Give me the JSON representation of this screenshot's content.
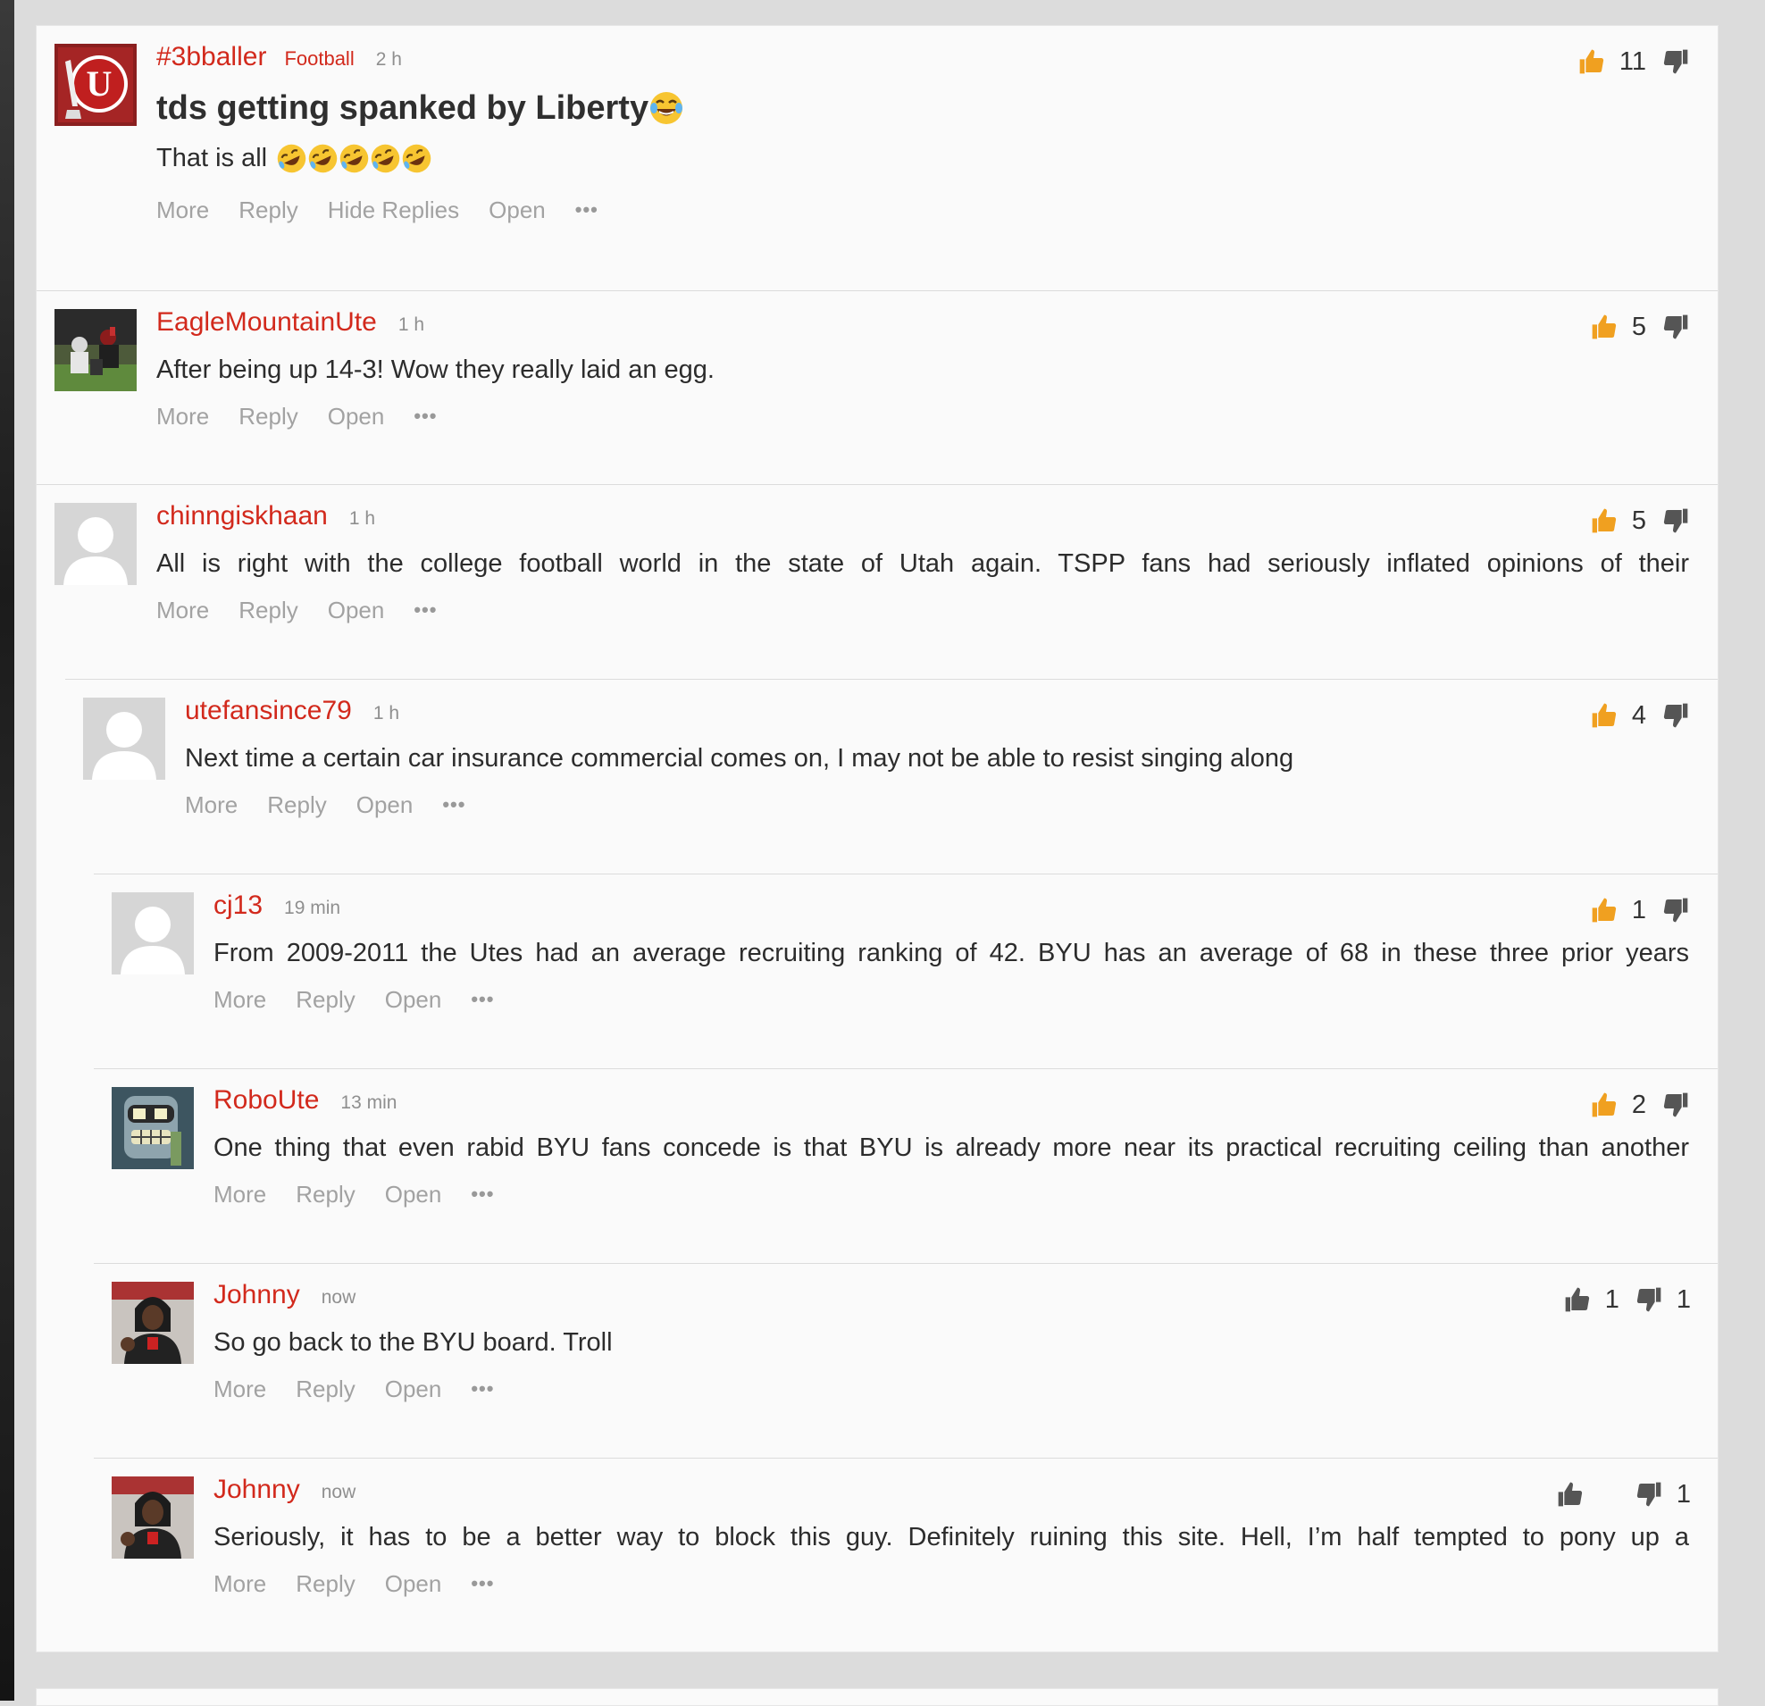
{
  "comments": [
    {
      "username": "#3bballer",
      "category": "Football",
      "time": "2 h",
      "title": "tds getting spanked by Liberty",
      "text": "That is all",
      "avatar": "utah-u-logo",
      "upvotes": "11",
      "downvotes": "",
      "up_active": true,
      "actions": [
        "More",
        "Reply",
        "Hide Replies",
        "Open"
      ]
    },
    {
      "username": "EagleMountainUte",
      "time": "1 h",
      "text": "After being up 14-3! Wow they really laid an egg.",
      "avatar": "football-photo",
      "upvotes": "5",
      "downvotes": "",
      "up_active": true,
      "actions": [
        "More",
        "Reply",
        "Open"
      ]
    },
    {
      "username": "chinngiskhaan",
      "time": "1 h",
      "text": "All is right with the college football world in the state of Utah again. TSPP fans had seriously inflated opinions of their",
      "avatar": "default-avatar",
      "upvotes": "5",
      "downvotes": "",
      "up_active": true,
      "actions": [
        "More",
        "Reply",
        "Open"
      ]
    },
    {
      "username": "utefansince79",
      "time": "1 h",
      "text": "Next time a certain car insurance commercial comes on, I may not be able to resist singing along",
      "avatar": "default-avatar",
      "upvotes": "4",
      "downvotes": "",
      "up_active": true,
      "actions": [
        "More",
        "Reply",
        "Open"
      ]
    },
    {
      "username": "cj13",
      "time": "19 min",
      "text": "From 2009-2011 the Utes had an average recruiting ranking of 42. BYU has an average of 68 in these three prior years",
      "avatar": "default-avatar",
      "upvotes": "1",
      "downvotes": "",
      "up_active": true,
      "actions": [
        "More",
        "Reply",
        "Open"
      ]
    },
    {
      "username": "RoboUte",
      "time": "13 min",
      "text": "One thing that even rabid BYU fans concede is that BYU is already more near its practical recruiting ceiling than another",
      "avatar": "robot-avatar",
      "upvotes": "2",
      "downvotes": "",
      "up_active": true,
      "actions": [
        "More",
        "Reply",
        "Open"
      ]
    },
    {
      "username": "Johnny",
      "time": "now",
      "text": "So go back to the BYU board. Troll",
      "avatar": "player-photo",
      "upvotes": "1",
      "downvotes": "1",
      "up_active": false,
      "actions": [
        "More",
        "Reply",
        "Open"
      ]
    },
    {
      "username": "Johnny",
      "time": "now",
      "text": "Seriously, it has to be a better way to block this guy. Definitely ruining this site. Hell, I’m half tempted to pony up a",
      "avatar": "player-photo",
      "upvotes": "",
      "downvotes": "1",
      "up_active": false,
      "actions": [
        "More",
        "Reply",
        "Open"
      ]
    }
  ],
  "more_label": "•••",
  "colors": {
    "accent": "#d2291c",
    "thumb_active": "#f0a020",
    "thumb_inactive": "#555555",
    "muted": "#a2a2a2"
  }
}
